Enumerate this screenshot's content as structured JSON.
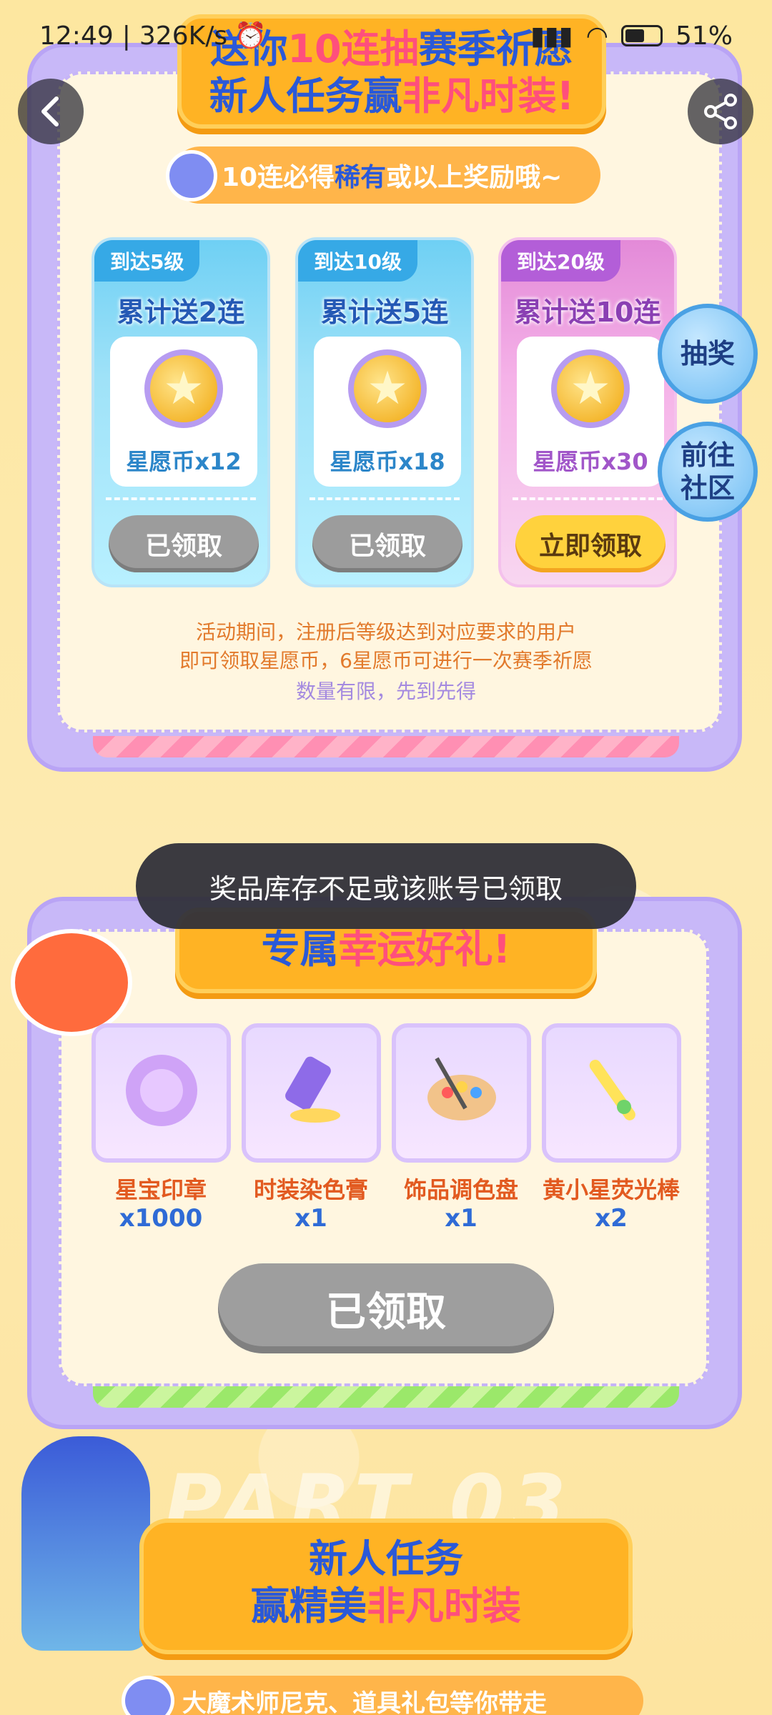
{
  "status_bar": {
    "time": "12:49",
    "speed": "326K/s",
    "battery": "51%"
  },
  "section1": {
    "banner_line1_a": "送你",
    "banner_line1_b": "10连抽",
    "banner_line1_c": "赛季祈愿",
    "banner_line2_a": "新人任务赢",
    "banner_line2_b": "非凡时装!",
    "note_a": "10连必得",
    "note_b": "稀有",
    "note_c": "或以上奖励哦~",
    "cards": [
      {
        "tag": "到达5级",
        "title": "累计送2连",
        "coin": "星愿币x12",
        "button": "已领取",
        "state": "disabled"
      },
      {
        "tag": "到达10级",
        "title": "累计送5连",
        "coin": "星愿币x18",
        "button": "已领取",
        "state": "disabled"
      },
      {
        "tag": "到达20级",
        "title": "累计送10连",
        "coin": "星愿币x30",
        "button": "立即领取",
        "state": "active"
      }
    ],
    "rule_line1": "活动期间，注册后等级达到对应要求的用户",
    "rule_line2": "即可领取星愿币，6星愿币可进行一次赛季祈愿",
    "rule_line3": "数量有限，先到先得"
  },
  "side_buttons": {
    "draw": "抽奖",
    "community": "前往社区"
  },
  "toast": "奖品库存不足或该账号已领取",
  "section2": {
    "banner_a": "专属",
    "banner_b": "幸运好礼!",
    "gifts": [
      {
        "name": "星宝印章",
        "qty": "x1000"
      },
      {
        "name": "时装染色膏",
        "qty": "x1"
      },
      {
        "name": "饰品调色盘",
        "qty": "x1"
      },
      {
        "name": "黄小星荧光棒",
        "qty": "x2"
      }
    ],
    "button": "已领取"
  },
  "section3": {
    "part_label": "PART 03",
    "banner_line1": "新人任务",
    "banner_line2_a": "赢精美",
    "banner_line2_b": "非凡时装",
    "tip": "大魔术师尼克、道具礼包等你带走"
  }
}
